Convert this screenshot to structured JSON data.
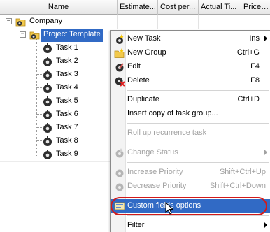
{
  "columns": {
    "name": "Name",
    "estimated": "Estimate...",
    "cost": "Cost per...",
    "actual": "Actual Ti...",
    "price": "Price pe"
  },
  "tree": {
    "root_label": "Company",
    "group_label": "Project Template",
    "tasks": [
      "Task 1",
      "Task 2",
      "Task 3",
      "Task 4",
      "Task 5",
      "Task 6",
      "Task 7",
      "Task 8",
      "Task 9"
    ],
    "toggle_symbol": "−"
  },
  "context_menu": {
    "new_task": {
      "label": "New Task",
      "shortcut": "Ins"
    },
    "new_group": {
      "label": "New Group",
      "shortcut": "Ctrl+G"
    },
    "edit": {
      "label": "Edit",
      "shortcut": "F4"
    },
    "delete": {
      "label": "Delete",
      "shortcut": "F8"
    },
    "duplicate": {
      "label": "Duplicate",
      "shortcut": "Ctrl+D"
    },
    "insert_copy": {
      "label": "Insert copy of task group..."
    },
    "roll_up": {
      "label": "Roll up recurrence task"
    },
    "change_status": {
      "label": "Change Status"
    },
    "increase_priority": {
      "label": "Increase Priority",
      "shortcut": "Shift+Ctrl+Up"
    },
    "decrease_priority": {
      "label": "Decrease Priority",
      "shortcut": "Shift+Ctrl+Down"
    },
    "custom_fields": {
      "label": "Custom fields options"
    },
    "filter": {
      "label": "Filter"
    }
  },
  "colors": {
    "selection": "#316ac5",
    "highlight_ring": "#d11a1a",
    "disabled_text": "#a2a2a2"
  },
  "icons": {
    "group": "folder-gear-icon",
    "task": "task-gear-icon",
    "new_task": "new-task-icon",
    "new_group": "new-group-icon",
    "edit": "edit-icon",
    "delete": "delete-icon",
    "change_status": "change-status-icon",
    "increase_priority": "increase-priority-icon",
    "decrease_priority": "decrease-priority-icon",
    "custom_fields": "custom-fields-icon",
    "pointer": "mouse-pointer-icon"
  }
}
